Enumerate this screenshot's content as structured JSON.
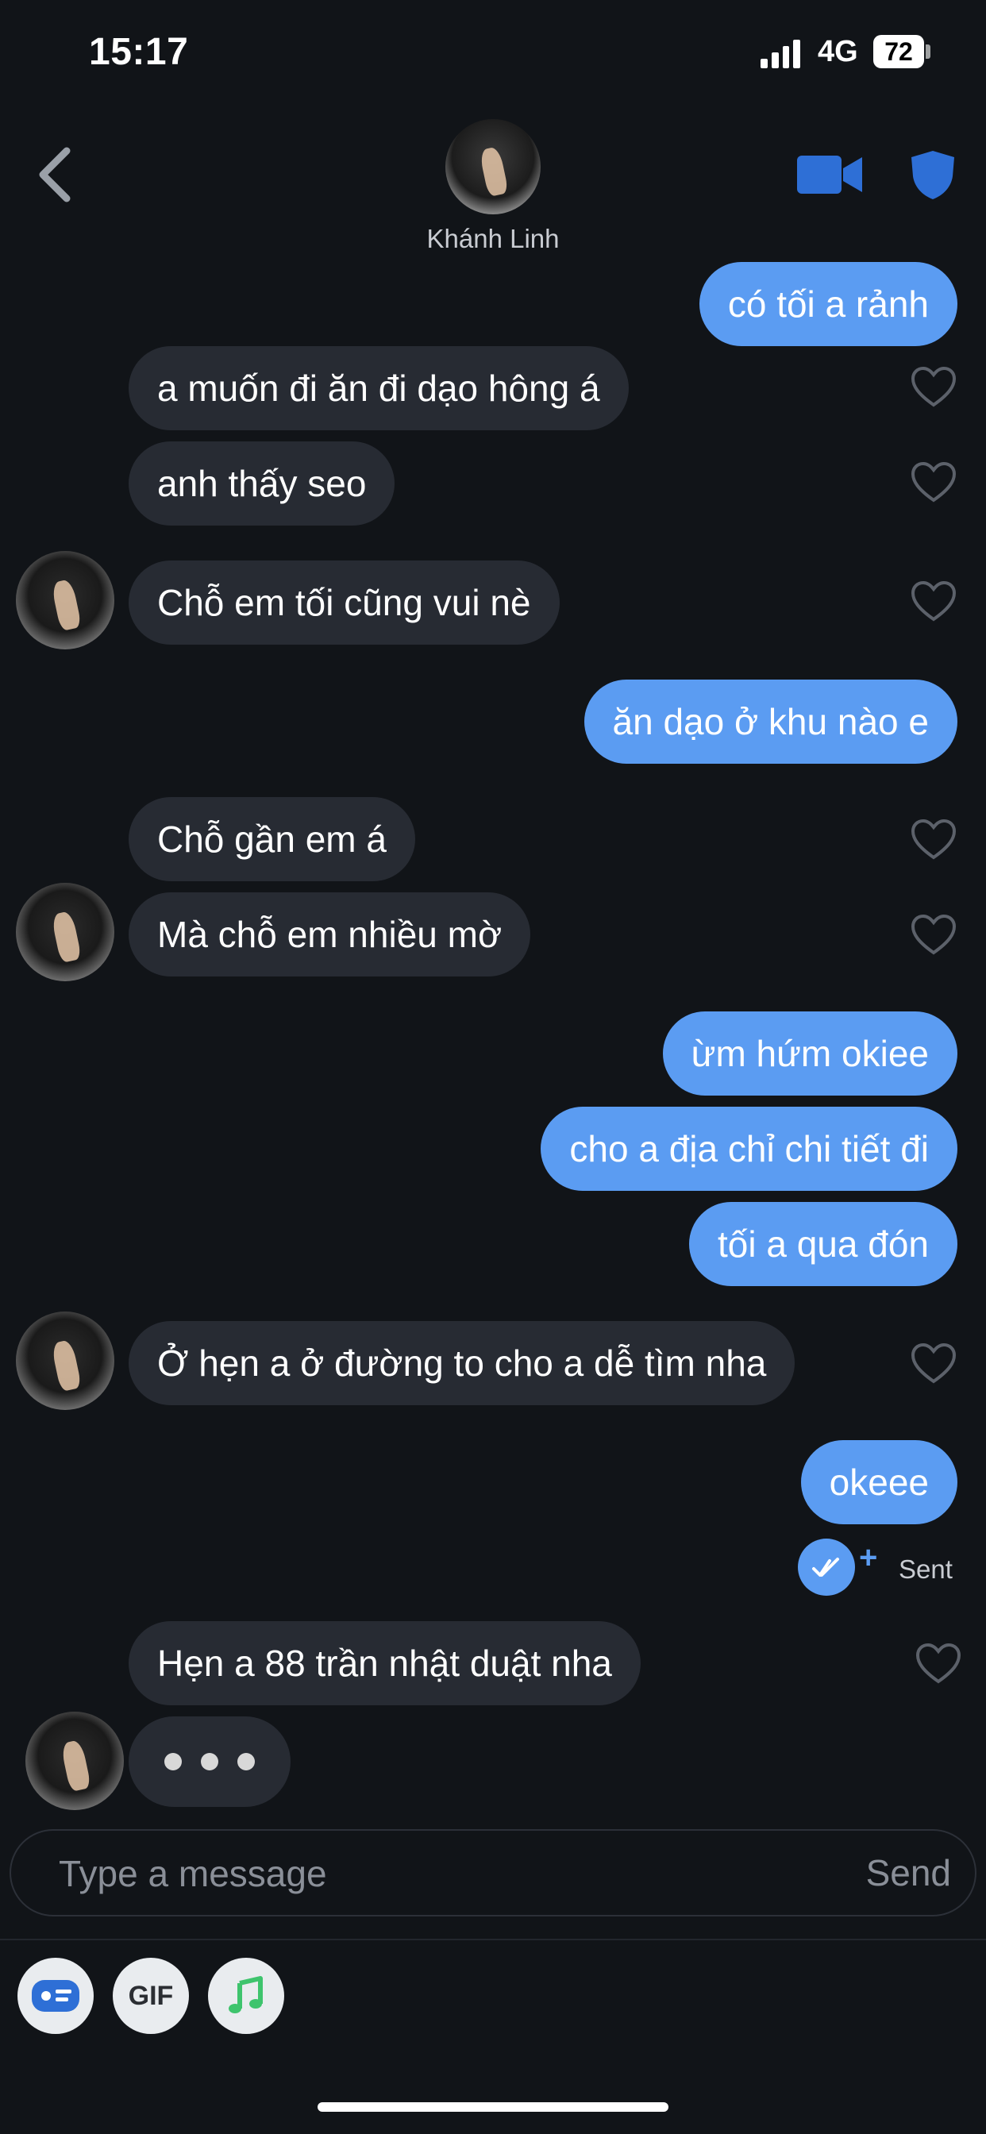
{
  "status_bar": {
    "time": "15:17",
    "network": "4G",
    "battery": "72"
  },
  "header": {
    "name": "Khánh Linh"
  },
  "messages": [
    {
      "text": "có tối a rảnh",
      "from": "me"
    },
    {
      "text": "a muốn đi ăn đi dạo hông á",
      "from": "them"
    },
    {
      "text": "anh thấy seo",
      "from": "them"
    },
    {
      "text": "Chỗ em tối cũng vui nè",
      "from": "them"
    },
    {
      "text": "ăn dạo ở khu nào e",
      "from": "me"
    },
    {
      "text": "Chỗ gần em á",
      "from": "them"
    },
    {
      "text": "Mà chỗ em nhiều mờ",
      "from": "them"
    },
    {
      "text": "ừm hứm okiee",
      "from": "me"
    },
    {
      "text": "cho a địa chỉ chi tiết đi",
      "from": "me"
    },
    {
      "text": "tối a qua đón",
      "from": "me"
    },
    {
      "text": "Ở hẹn a ở đường to cho a dễ tìm nha",
      "from": "them"
    },
    {
      "text": "okeee",
      "from": "me"
    },
    {
      "text": "Hẹn a 88 trần nhật duật nha",
      "from": "them"
    }
  ],
  "receipt": {
    "label": "Sent",
    "plus": "+"
  },
  "composer": {
    "placeholder": "Type a message",
    "send_label": "Send"
  },
  "tools": {
    "gif_label": "GIF"
  },
  "colors": {
    "background": "#111418",
    "outgoing": "#5b9cf2",
    "incoming": "#272b33",
    "accent": "#2e6fd6",
    "music": "#3ec46d"
  },
  "icons": [
    "back-chevron-icon",
    "video-camera-icon",
    "shield-icon",
    "heart-icon",
    "double-check-icon",
    "id-card-icon",
    "music-note-icon"
  ]
}
